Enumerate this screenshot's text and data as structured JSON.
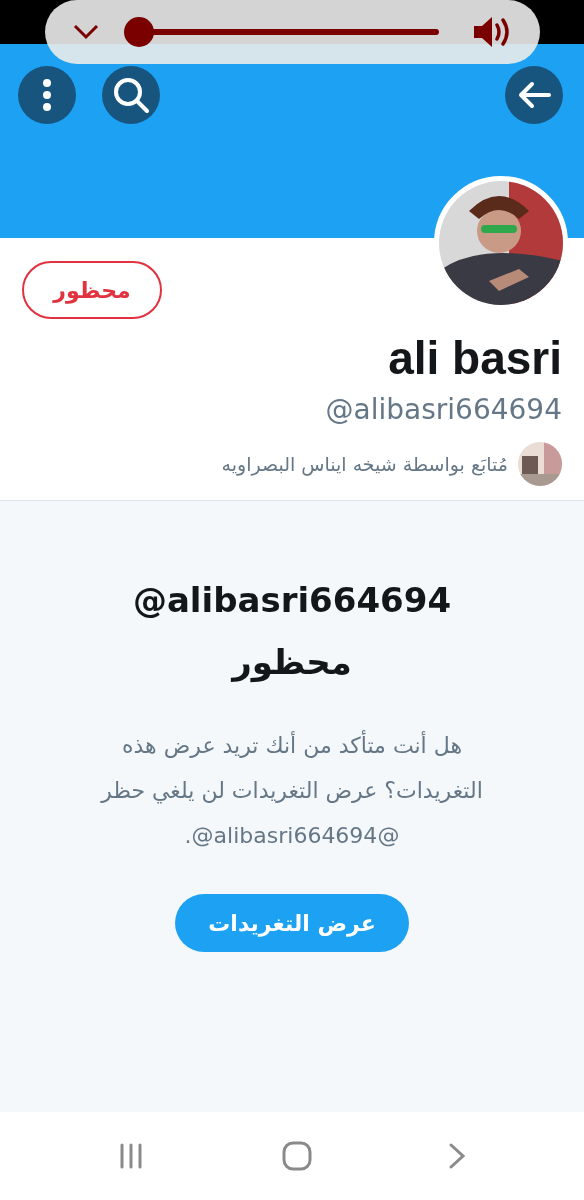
{
  "volume": {
    "level": 0.02
  },
  "profile": {
    "blocked_label": "محظور",
    "name": "ali basri",
    "handle": "@alibasri664694",
    "followed_by": "مُتابَع بواسطة شيخه ايناس البصراويه"
  },
  "blocked_notice": {
    "title": "@alibasri664694 محظور",
    "message": "هل أنت متأكد من أنك تريد عرض هذه التغريدات؟ عرض التغريدات لن يلغي حظر @alibasri664694@.",
    "button": "عرض التغريدات"
  }
}
